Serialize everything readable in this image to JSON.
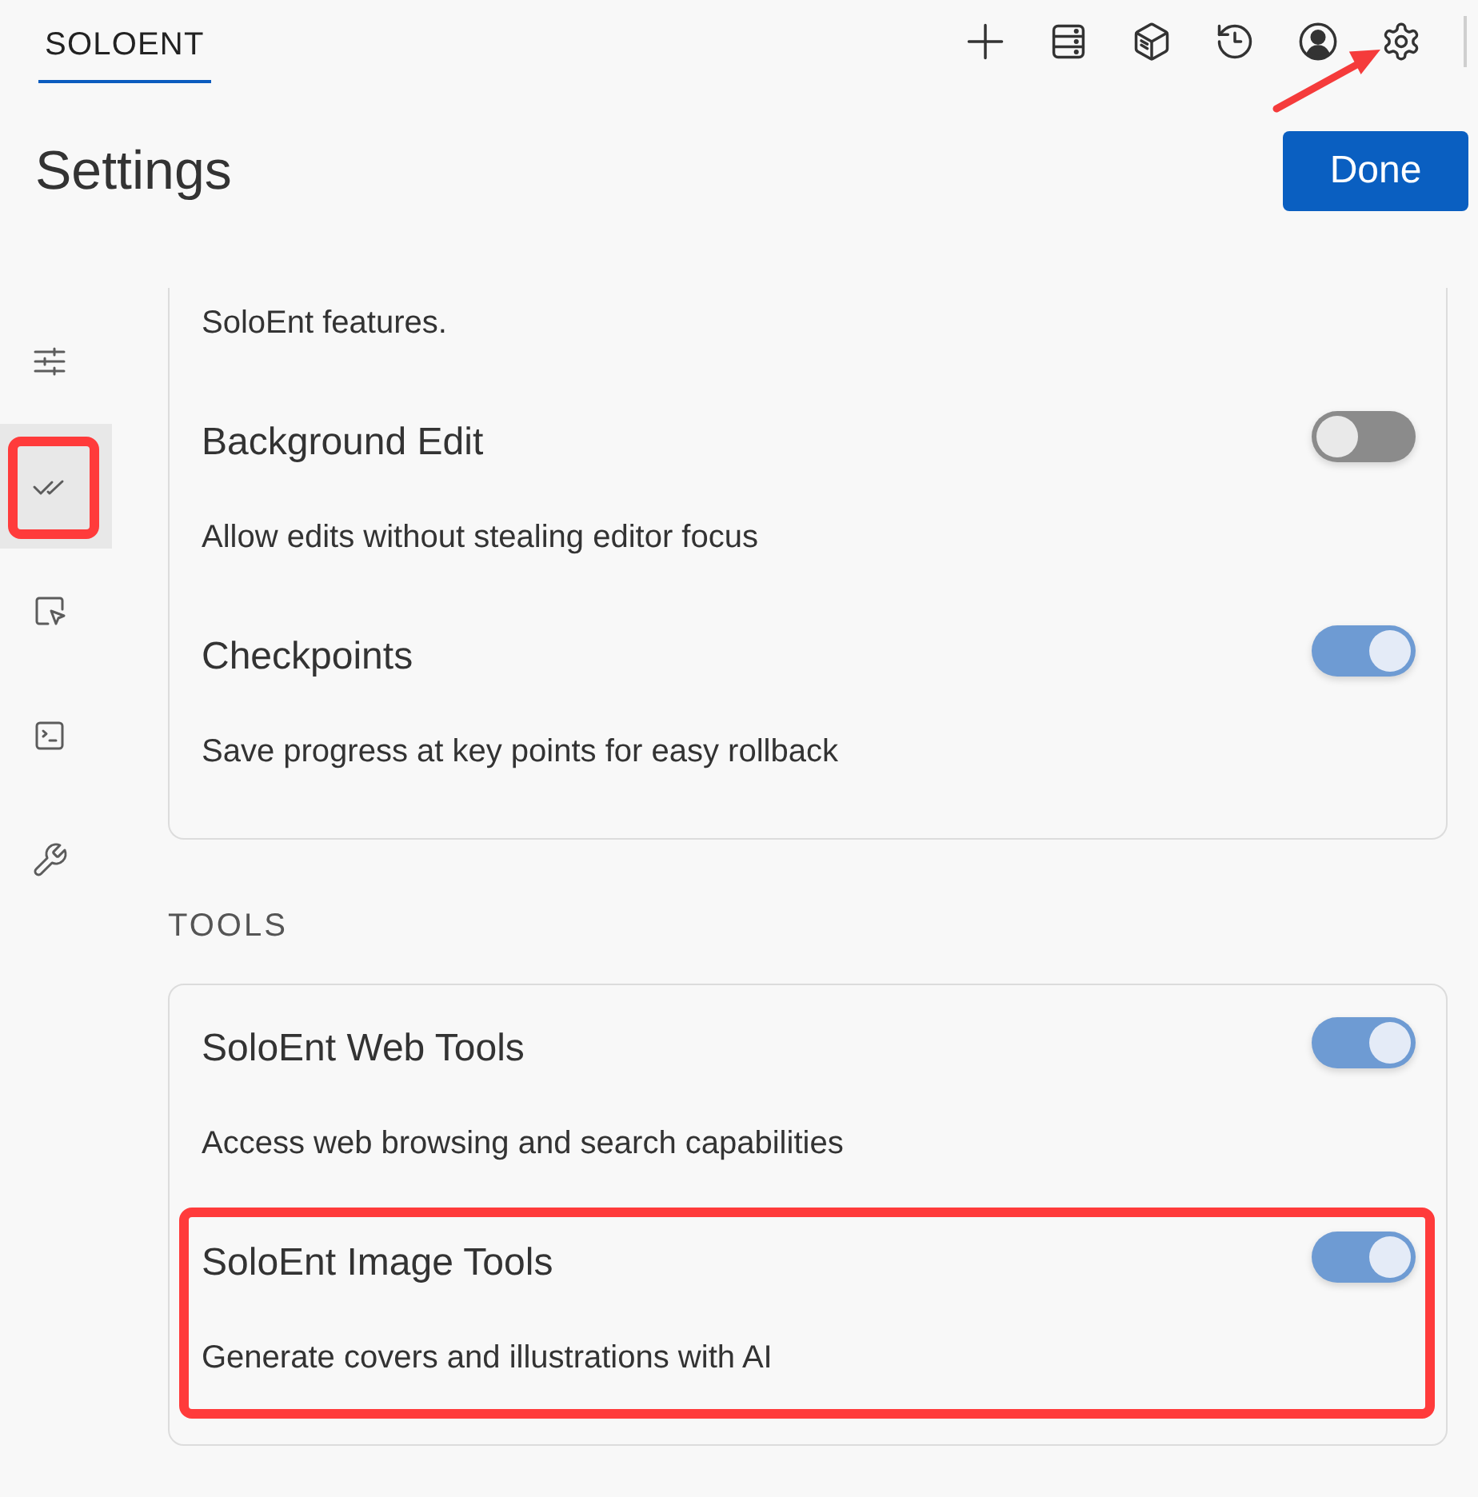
{
  "header": {
    "tabs": [
      {
        "label": "SOLOENT",
        "selected": true
      }
    ],
    "toolbar_icons": [
      {
        "pointed": false
      },
      {
        "pointed": false
      },
      {
        "pointed": false
      },
      {
        "pointed": false
      },
      {
        "pointed": false
      },
      {
        "pointed": true
      }
    ]
  },
  "page": {
    "title": "Settings",
    "done_button": "Done"
  },
  "sidebar": {
    "items": [
      {
        "selected": false,
        "highlighted": false
      },
      {
        "selected": true,
        "highlighted": true
      },
      {
        "selected": false,
        "highlighted": false
      },
      {
        "selected": false,
        "highlighted": false
      },
      {
        "selected": false,
        "highlighted": false
      }
    ]
  },
  "sections": [
    {
      "cut_off_text": "SoloEnt features.",
      "items": [
        {
          "title": "Background Edit",
          "description": "Allow edits without stealing editor focus",
          "on": false,
          "highlighted": false
        },
        {
          "title": "Checkpoints",
          "description": "Save progress at key points for easy rollback",
          "on": true,
          "highlighted": false
        }
      ]
    },
    {
      "heading": "TOOLS",
      "items": [
        {
          "title": "SoloEnt Web Tools",
          "description": "Access web browsing and search capabilities",
          "on": true,
          "highlighted": false
        },
        {
          "title": "SoloEnt Image Tools",
          "description": "Generate covers and illustrations with AI",
          "on": true,
          "highlighted": true
        }
      ]
    }
  ]
}
